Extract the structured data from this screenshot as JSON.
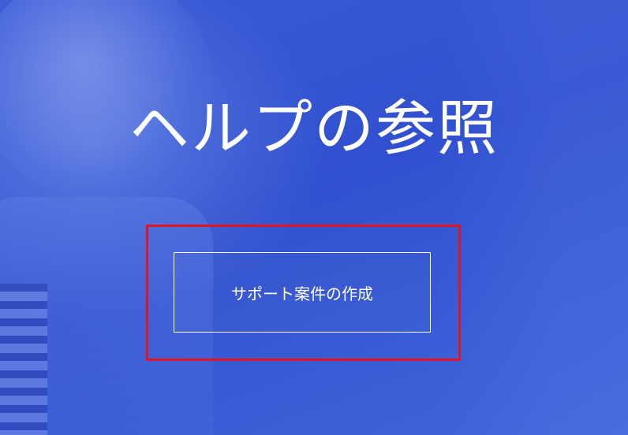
{
  "hero": {
    "title": "ヘルプの参照",
    "button_label": "サポート案件の作成"
  },
  "colors": {
    "background": "#3554d1",
    "text": "#ffffff",
    "highlight": "#e3141e"
  }
}
